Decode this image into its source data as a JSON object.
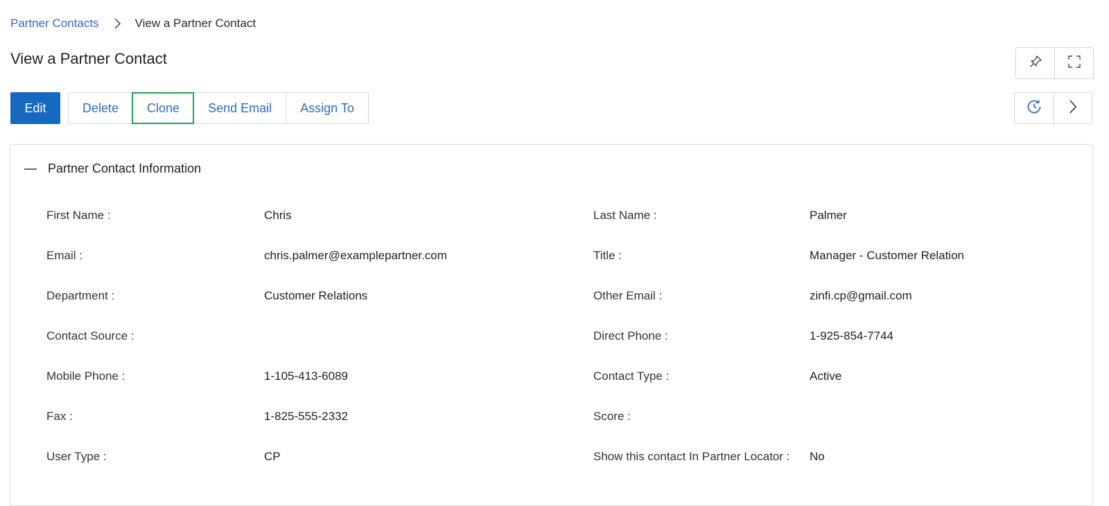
{
  "breadcrumb": {
    "parent": "Partner Contacts",
    "current": "View a Partner Contact"
  },
  "page": {
    "title": "View a Partner Contact"
  },
  "toolbar": {
    "edit": "Edit",
    "delete": "Delete",
    "clone": "Clone",
    "send_email": "Send Email",
    "assign_to": "Assign To"
  },
  "icons": {
    "pin": "pin-icon",
    "fullscreen": "fullscreen-icon",
    "history": "history-icon",
    "next": "chevron-right-icon",
    "collapse": "minus-icon"
  },
  "colors": {
    "primary": "#1569bf",
    "link": "#2f6cc0",
    "focus": "#1aa34a"
  },
  "section": {
    "title": "Partner Contact Information",
    "left": [
      {
        "label": "First Name :",
        "value": "Chris"
      },
      {
        "label": "Email :",
        "value": "chris.palmer@examplepartner.com"
      },
      {
        "label": "Department :",
        "value": "Customer Relations"
      },
      {
        "label": "Contact Source :",
        "value": ""
      },
      {
        "label": "Mobile Phone :",
        "value": "1-105-413-6089"
      },
      {
        "label": "Fax :",
        "value": "1-825-555-2332"
      },
      {
        "label": "User Type :",
        "value": "CP"
      }
    ],
    "right": [
      {
        "label": "Last Name :",
        "value": "Palmer"
      },
      {
        "label": "Title :",
        "value": "Manager - Customer Relation"
      },
      {
        "label": "Other Email :",
        "value": "zinfi.cp@gmail.com"
      },
      {
        "label": "Direct Phone :",
        "value": "1-925-854-7744"
      },
      {
        "label": "Contact Type :",
        "value": "Active"
      },
      {
        "label": "Score :",
        "value": ""
      },
      {
        "label": "Show this contact In Partner Locator :",
        "value": "No"
      }
    ]
  }
}
